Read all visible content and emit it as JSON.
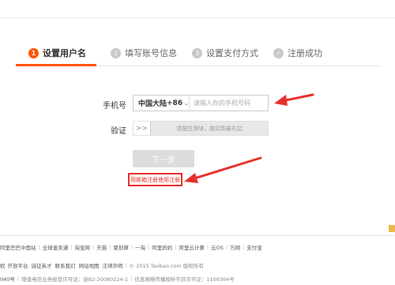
{
  "steps": [
    {
      "num": "1",
      "label": "设置用户名",
      "active": true
    },
    {
      "num": "2",
      "label": "填写账号信息",
      "active": false
    },
    {
      "num": "3",
      "label": "设置支付方式",
      "active": false
    },
    {
      "icon": "✓",
      "label": "注册成功",
      "active": false
    }
  ],
  "form": {
    "phone_label": "手机号",
    "country": "中国大陆",
    "code": "+86",
    "code_chevron": "⌄",
    "phone_placeholder": "请输入你的手机号码",
    "verify_label": "验证",
    "slider_handle": ">>",
    "slider_text": "请按住滑块，拖动到最右边",
    "next_button": "下一步",
    "email_link": "用邮箱注册使用注册"
  },
  "colors": {
    "accent": "#ff5500",
    "annotation_red": "#e8302b"
  },
  "footer": {
    "links_row1": [
      "阿里巴巴中国站",
      "全球速卖通",
      "淘宝网",
      "天猫",
      "聚划算",
      "一淘",
      "阿里妈妈",
      "阿里云计算",
      "云OS",
      "万网",
      "支付宝"
    ],
    "links_row2": [
      "权",
      "开放平台",
      "诚征英才",
      "联系我们",
      "网站地图",
      "法律声明"
    ],
    "copyright": "© 2015 Taobao.com 版权所有",
    "license_left": "040号",
    "license_mid": "增值电信业务经营许可证：浙B2-20080224-1",
    "license_right": "信息网络传播视听节目许可证：1109364号"
  }
}
